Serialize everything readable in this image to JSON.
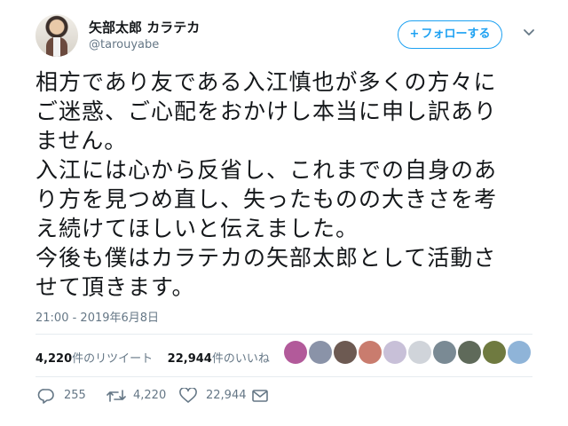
{
  "user": {
    "name": "矢部太郎 カラテカ",
    "handle": "@tarouyabe",
    "follow_label": "フォローする",
    "follow_plus": "+"
  },
  "tweet": {
    "lines": [
      "相方であり友である入江慎也が多くの方々に",
      "ご迷惑、ご心配をおかけし本当に申し訳あり",
      "ません。",
      "入江には心から反省し、これまでの自身のあ",
      "り方を見つめ直し、失ったものの大きさを考",
      "え続けてほしいと伝えました。",
      "今後も僕はカラテカの矢部太郎として活動さ",
      "せて頂きます。"
    ],
    "timestamp": "21:00 - 2019年6月8日"
  },
  "stats": {
    "retweets_count": "4,220",
    "retweets_label": "件のリツイート",
    "likes_count": "22,944",
    "likes_label": "件のいいね"
  },
  "actions": {
    "reply_count": "255",
    "retweet_count": "4,220",
    "like_count": "22,944"
  },
  "colors": {
    "accent": "#1da1f2",
    "secondary_text": "#657786"
  },
  "icons": {
    "reply": "reply-icon",
    "retweet": "retweet-icon",
    "like": "heart-icon",
    "dm": "envelope-icon",
    "more": "chevron-down-icon"
  }
}
